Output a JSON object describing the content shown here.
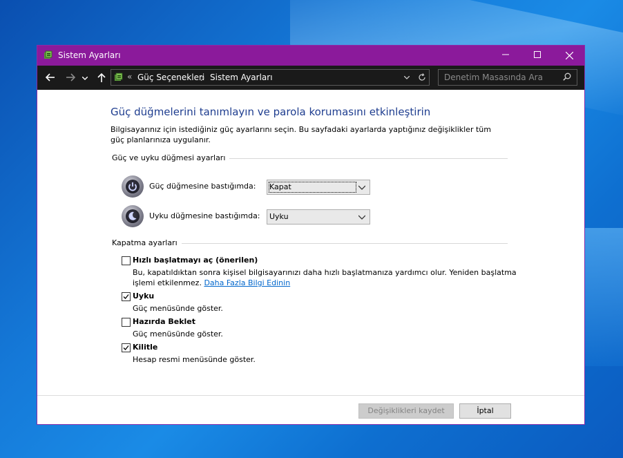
{
  "window": {
    "title": "Sistem Ayarları"
  },
  "navbar": {
    "crumb_prefix": "«",
    "breadcrumbs": [
      "Güç Seçenekleri",
      "Sistem Ayarları"
    ],
    "search_placeholder": "Denetim Masasında Ara"
  },
  "main": {
    "heading": "Güç düğmelerini tanımlayın ve parola korumasını etkinleştirin",
    "description": "Bilgisayarınız için istediğiniz güç ayarlarını seçin. Bu sayfadaki ayarlarda yaptığınız değişiklikler tüm güç planlarınıza uygulanır.",
    "power_group": {
      "label": "Güç ve uyku düğmesi ayarları",
      "power_button": {
        "label": "Güç düğmesine bastığımda:",
        "value": "Kapat"
      },
      "sleep_button": {
        "label": "Uyku düğmesine bastığımda:",
        "value": "Uyku"
      }
    },
    "shutdown_group": {
      "label": "Kapatma ayarları",
      "items": [
        {
          "title": "Hızlı başlatmayı aç (önerilen)",
          "checked": false,
          "desc": "Bu, kapatıldıktan sonra kişisel bilgisayarınızı daha hızlı başlatmanıza yardımcı olur. Yeniden başlatma işlemi etkilenmez.",
          "link": "Daha Fazla Bilgi Edinin"
        },
        {
          "title": "Uyku",
          "checked": true,
          "desc": "Güç menüsünde göster."
        },
        {
          "title": "Hazırda Beklet",
          "checked": false,
          "desc": "Güç menüsünde göster."
        },
        {
          "title": "Kilitle",
          "checked": true,
          "desc": "Hesap resmi menüsünde göster."
        }
      ]
    }
  },
  "footer": {
    "save_label": "Değişiklikleri kaydet",
    "cancel_label": "İptal"
  },
  "colors": {
    "titlebar": "#8b1a9b",
    "heading": "#1e3d8f",
    "link": "#0066cc"
  }
}
